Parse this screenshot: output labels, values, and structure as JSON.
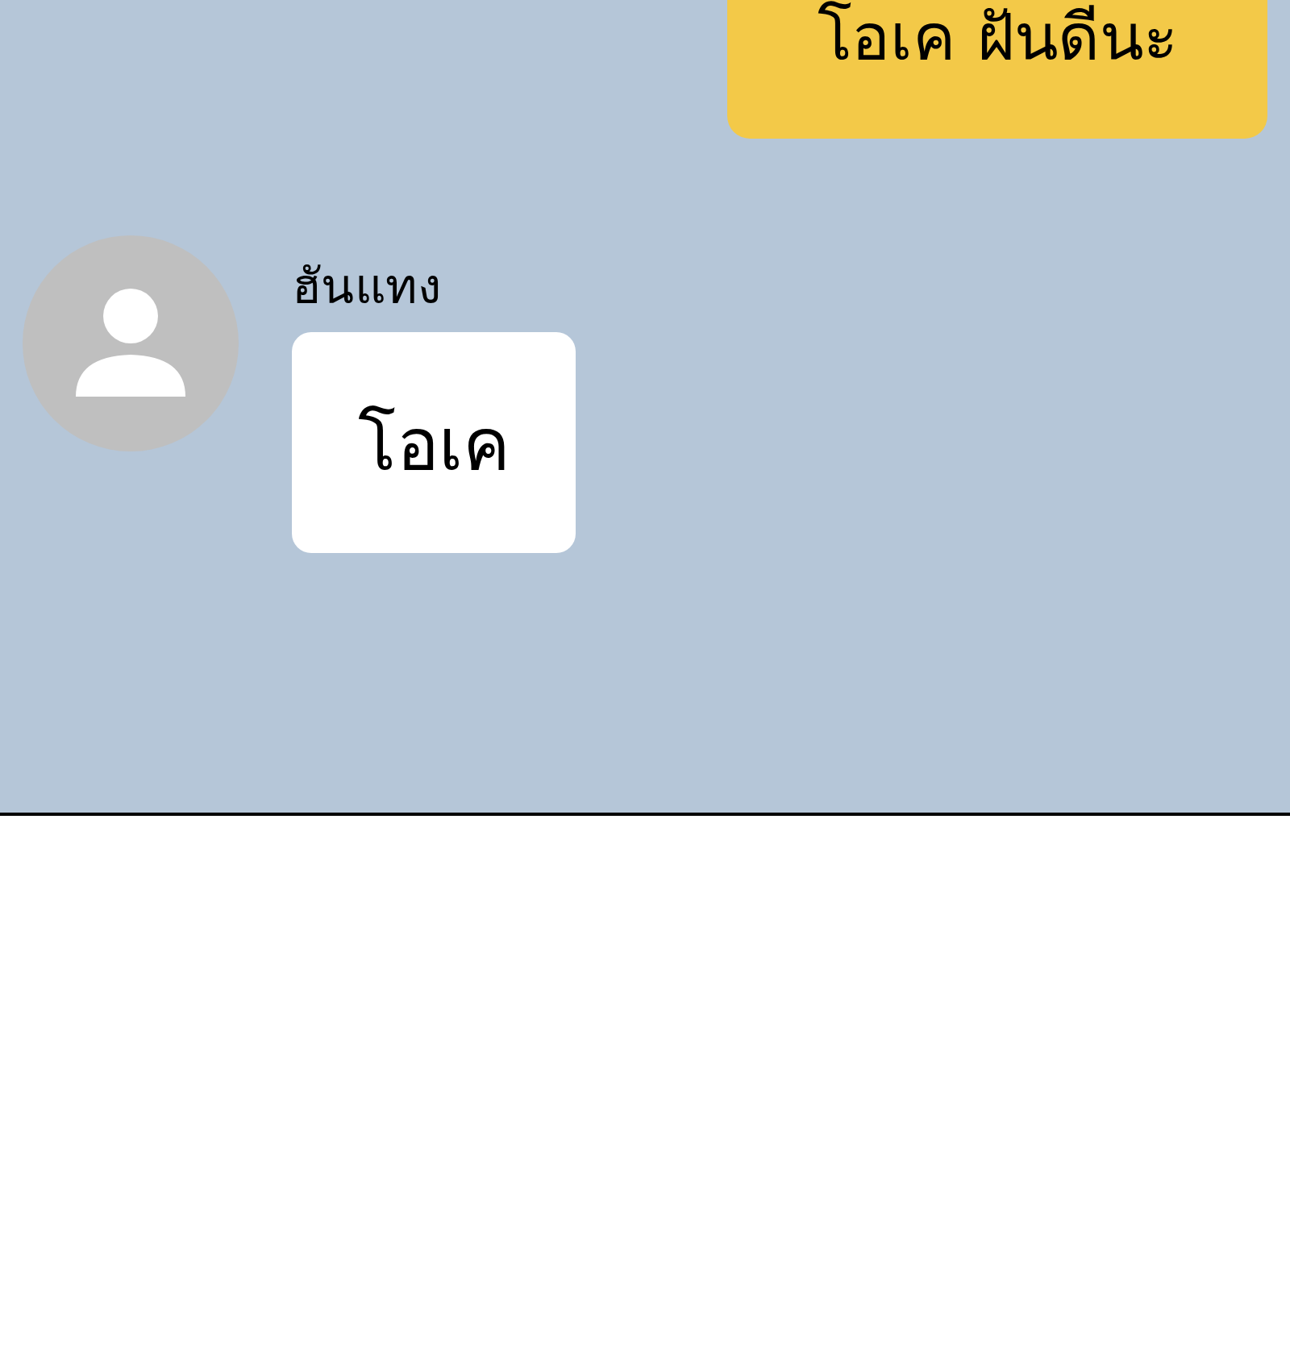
{
  "messages": [
    {
      "kind": "sent",
      "text": "โอเค ฝันดีนะ"
    },
    {
      "kind": "received",
      "sender": "ฮันแทง",
      "text": "โอเค"
    }
  ]
}
